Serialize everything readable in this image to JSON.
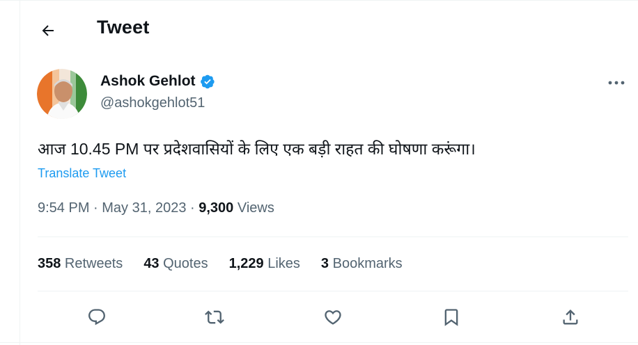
{
  "header": {
    "title": "Tweet",
    "back_icon": "arrow-left-icon"
  },
  "author": {
    "name": "Ashok Gehlot",
    "handle": "@ashokgehlot51",
    "verified_icon": "verified-badge-icon",
    "verified_color": "#1d9bf0"
  },
  "more_icon": "more-horizontal-icon",
  "tweet": {
    "text": "आज 10.45 PM पर प्रदेशवासियों के लिए एक बड़ी राहत की घोषणा करूंगा।",
    "translate_label": "Translate Tweet"
  },
  "meta": {
    "time": "9:54 PM",
    "separator": " · ",
    "date": "May 31, 2023",
    "views_count": "9,300",
    "views_label": " Views"
  },
  "stats": [
    {
      "count": "358",
      "label": " Retweets"
    },
    {
      "count": "43",
      "label": " Quotes"
    },
    {
      "count": "1,229",
      "label": " Likes"
    },
    {
      "count": "3",
      "label": " Bookmarks"
    }
  ],
  "actions": [
    "reply-icon",
    "retweet-icon",
    "like-icon",
    "bookmark-icon",
    "share-icon"
  ],
  "colors": {
    "text": "#0f1419",
    "secondary": "#536471",
    "accent": "#1d9bf0",
    "border": "#eff3f4"
  }
}
